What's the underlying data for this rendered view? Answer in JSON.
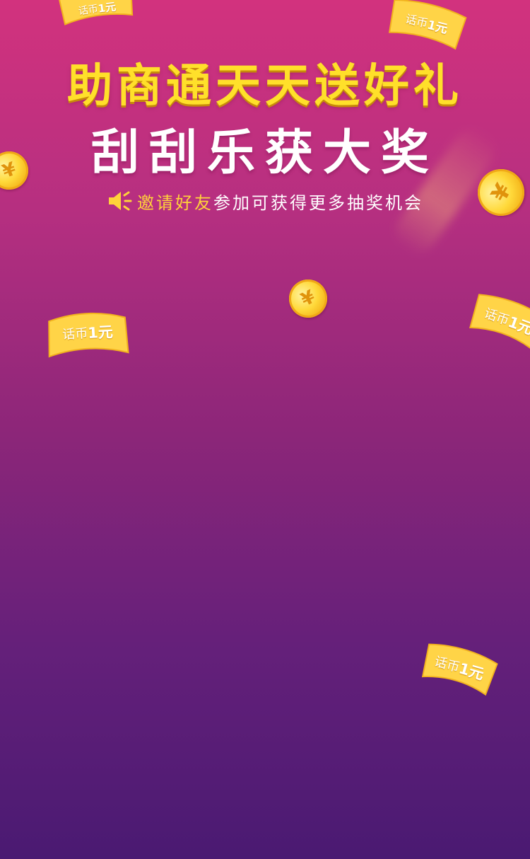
{
  "banner": {
    "title_line_1": "助商通天天送好礼",
    "title_line_2": "刮刮乐获大奖",
    "subtitle_highlight": "邀请好友",
    "subtitle_rest": "参加可获得更多抽奖机会"
  },
  "decorations": {
    "ticket_label": "话币",
    "ticket_amount": "1元",
    "coin_symbol": "¥"
  },
  "colors": {
    "background_top": "#d2327e",
    "background_bottom": "#4a1a72",
    "title_yellow": "#ffe02a",
    "subtitle_highlight": "#ffd23a",
    "coin_gold": "#ffd93a"
  }
}
